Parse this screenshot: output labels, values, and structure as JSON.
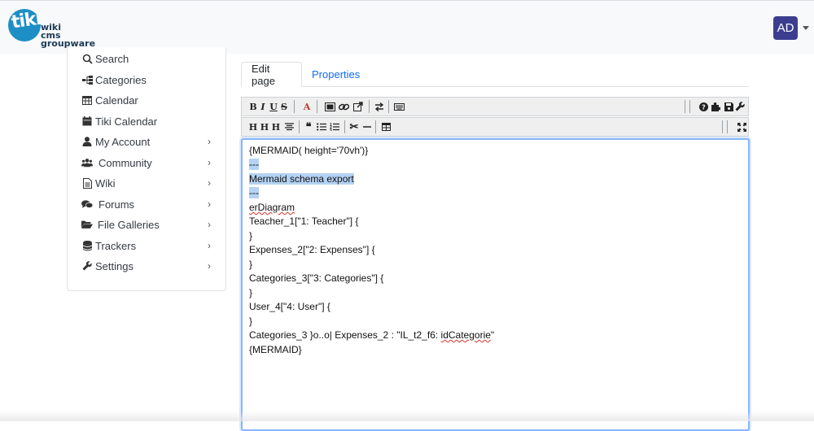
{
  "brand": {
    "logo_mark": "tiki",
    "logo_lines": [
      "wiki",
      "cms",
      "groupware"
    ]
  },
  "user": {
    "avatar_initials": "AD"
  },
  "sidebar": {
    "items": [
      {
        "label": "Search",
        "icon": "search-icon",
        "has_submenu": false
      },
      {
        "label": "Categories",
        "icon": "sitemap-icon",
        "has_submenu": false
      },
      {
        "label": "Calendar",
        "icon": "calendar-grid-icon",
        "has_submenu": false
      },
      {
        "label": "Tiki Calendar",
        "icon": "calendar-icon",
        "has_submenu": false
      },
      {
        "label": "My Account",
        "icon": "user-icon",
        "has_submenu": true
      },
      {
        "label": "Community",
        "icon": "users-icon",
        "has_submenu": true
      },
      {
        "label": "Wiki",
        "icon": "file-icon",
        "has_submenu": true
      },
      {
        "label": "Forums",
        "icon": "comments-icon",
        "has_submenu": true
      },
      {
        "label": "File Galleries",
        "icon": "folder-open-icon",
        "has_submenu": true
      },
      {
        "label": "Trackers",
        "icon": "database-icon",
        "has_submenu": true
      },
      {
        "label": "Settings",
        "icon": "wrench-icon",
        "has_submenu": true
      }
    ]
  },
  "tabs": [
    {
      "label": "Edit page",
      "active": true
    },
    {
      "label": "Properties",
      "active": false
    }
  ],
  "toolbar": {
    "row1": [
      "bold-icon",
      "italic-icon",
      "underline-icon",
      "strikethrough-icon",
      "text-color-icon",
      "image-icon",
      "link-icon",
      "external-link-icon",
      "switch-editor-icon",
      "keyboard-icon",
      "help-icon",
      "plugin-icon",
      "save-icon",
      "admin-icon"
    ],
    "row2": [
      "heading1-icon",
      "heading2-icon",
      "heading3-icon",
      "align-center-icon",
      "quote-icon",
      "bullet-list-icon",
      "numbered-list-icon",
      "cut-icon",
      "horizontal-rule-icon",
      "table-icon",
      "fullscreen-icon"
    ]
  },
  "editor": {
    "lines": [
      "{MERMAID( height='70vh')}",
      "---",
      "Mermaid schema export",
      "---",
      "erDiagram",
      "Teacher_1[\"1: Teacher\"] {",
      "}",
      "Expenses_2[\"2: Expenses\"] {",
      "}",
      "Categories_3[\"3: Categories\"] {",
      "}",
      "User_4[\"4: User\"] {",
      "}",
      "Categories_3 }o..o| Expenses_2 : \"IL_t2_f6: ",
      "idCategorie",
      "\"",
      "{MERMAID}"
    ]
  },
  "colors": {
    "accent": "#0d6efd",
    "avatar_bg": "#3d3d8f",
    "logo_blue": "#1d8fc4",
    "selection": "#b4d2f3"
  }
}
